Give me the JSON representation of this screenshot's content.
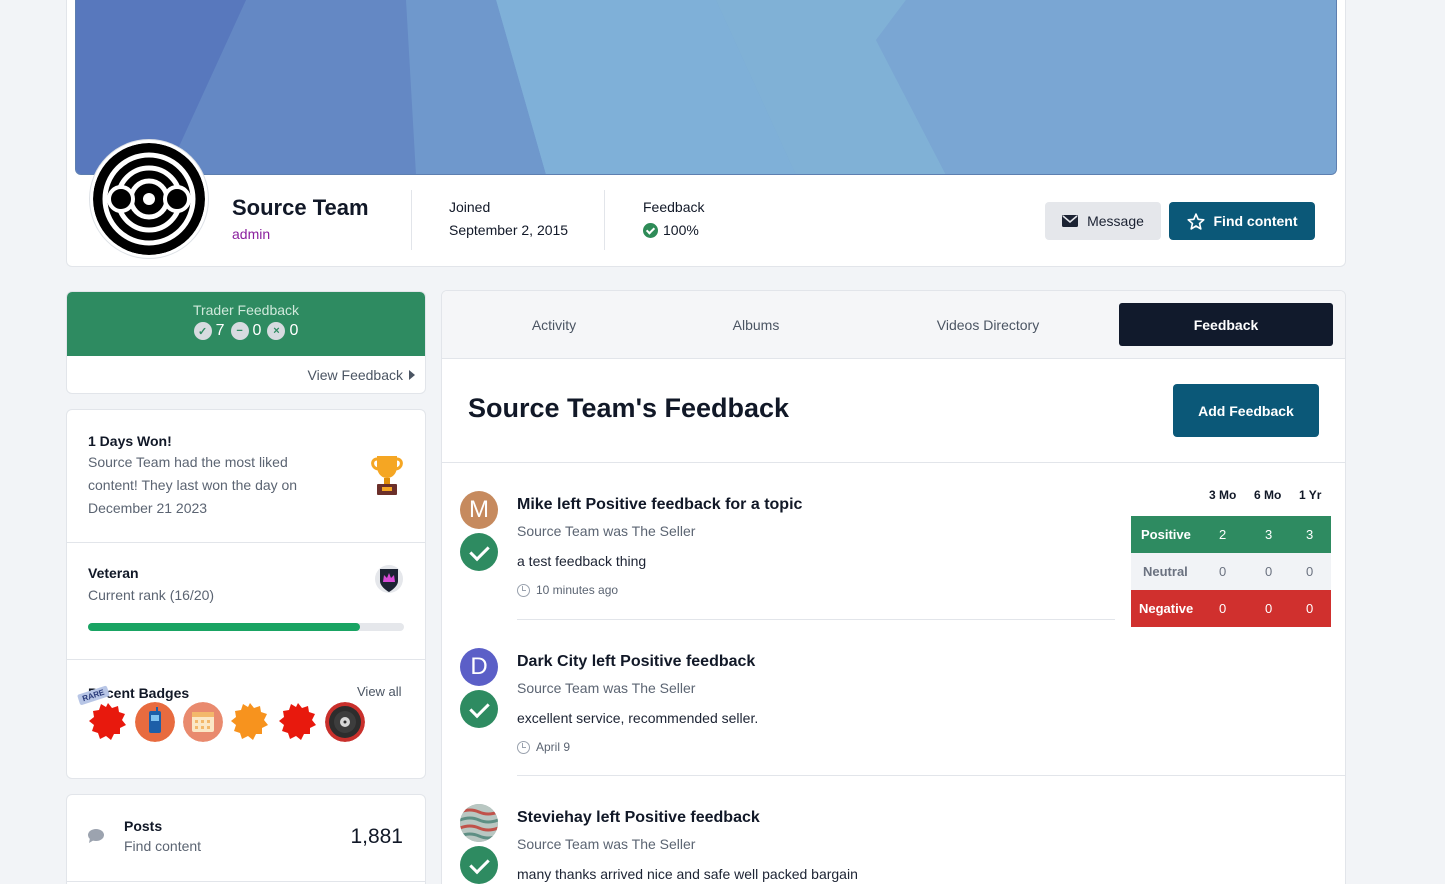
{
  "profile": {
    "name": "Source Team",
    "role": "admin",
    "joined_label": "Joined",
    "joined_value": "September 2, 2015",
    "feedback_label": "Feedback",
    "feedback_value": "100%",
    "message_label": "Message",
    "find_content_label": "Find content"
  },
  "trader": {
    "title": "Trader Feedback",
    "positive": "7",
    "neutral": "0",
    "negative": "0",
    "view_label": "View Feedback"
  },
  "days_won": {
    "title": "1 Days Won!",
    "text": "Source Team had the most liked content! They last won the day on December 21 2023"
  },
  "rank": {
    "title": "Veteran",
    "text": "Current rank (16/20)",
    "progress_fraction": 0.86
  },
  "badges": {
    "title": "Recent Badges",
    "view_all": "View all",
    "rare_label": "RARE"
  },
  "posts": {
    "label": "Posts",
    "link": "Find content",
    "count": "1,881"
  },
  "tabs": [
    "Activity",
    "Albums",
    "Videos Directory",
    "Feedback"
  ],
  "feedback_section": {
    "title": "Source Team's Feedback",
    "add_label": "Add Feedback"
  },
  "entries": [
    {
      "initial": "M",
      "color": "#c68a5e",
      "title": "Mike left Positive feedback for a topic",
      "sub": "Source Team was The Seller",
      "body": "a test feedback thing",
      "time": "10 minutes ago"
    },
    {
      "initial": "D",
      "color": "#5b5fc7",
      "title": "Dark City left Positive feedback",
      "sub": "Source Team was The Seller",
      "body": "excellent service, recommended seller.",
      "time": "April 9"
    },
    {
      "initial": "",
      "color": "#8aa8a0",
      "title": "Steviehay left Positive feedback",
      "sub": "Source Team was The Seller",
      "body": "many thanks arrived nice and safe well packed bargain",
      "time": ""
    }
  ],
  "stats": {
    "headers": [
      "3 Mo",
      "6 Mo",
      "1 Yr"
    ],
    "rows": [
      {
        "label": "Positive",
        "values": [
          "2",
          "3",
          "3"
        ],
        "bg": "#2e8b61",
        "fg": "#ffffff"
      },
      {
        "label": "Neutral",
        "values": [
          "0",
          "0",
          "0"
        ],
        "bg": "#f1f3f6",
        "fg": "#6b7280"
      },
      {
        "label": "Negative",
        "values": [
          "0",
          "0",
          "0"
        ],
        "bg": "#d0302e",
        "fg": "#ffffff"
      }
    ]
  }
}
